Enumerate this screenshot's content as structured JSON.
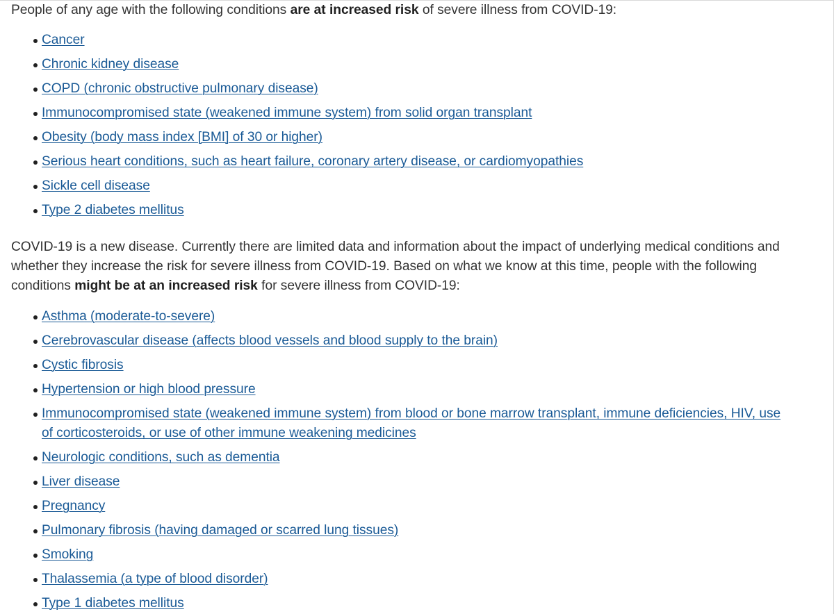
{
  "page": {
    "background_color": "#ffffff",
    "text_color": "#333333",
    "link_color": "#1a5a96"
  },
  "intro_paragraph": {
    "part1": "People of any age with the following conditions ",
    "emphasis": "are at increased risk",
    "part2": " of severe illness from COVID-19:"
  },
  "increased_risk_list": [
    {
      "label": "Cancer"
    },
    {
      "label": "Chronic kidney disease"
    },
    {
      "label": "COPD (chronic obstructive pulmonary disease)"
    },
    {
      "label": "Immunocompromised state (weakened immune system) from solid organ transplant"
    },
    {
      "label": "Obesity (body mass index [BMI] of 30 or higher)"
    },
    {
      "label": "Serious heart conditions, such as heart failure, coronary artery disease, or cardiomyopathies"
    },
    {
      "label": "Sickle cell disease"
    },
    {
      "label": "Type 2 diabetes mellitus"
    }
  ],
  "mid_paragraph": {
    "part1": "COVID-19 is a new disease. Currently there are limited data and information about the impact of underlying medical conditions and whether they increase the risk for severe illness from COVID-19. Based on what we know at this time, people with the following conditions ",
    "emphasis": "might be at an increased risk",
    "part2": " for severe illness from COVID-19:"
  },
  "might_be_at_risk_list": [
    {
      "label": "Asthma (moderate-to-severe)"
    },
    {
      "label": "Cerebrovascular disease (affects blood vessels and blood supply to the brain)"
    },
    {
      "label": "Cystic fibrosis"
    },
    {
      "label": "Hypertension or high blood pressure"
    },
    {
      "label": "Immunocompromised state (weakened immune system) from blood or bone marrow transplant, immune deficiencies, HIV, use of corticosteroids, or use of other immune weakening medicines"
    },
    {
      "label": "Neurologic conditions, such as dementia"
    },
    {
      "label": "Liver disease"
    },
    {
      "label": "Pregnancy"
    },
    {
      "label": "Pulmonary fibrosis (having damaged or scarred lung tissues)"
    },
    {
      "label": "Smoking"
    },
    {
      "label": "Thalassemia (a type of blood disorder)"
    },
    {
      "label": "Type 1 diabetes mellitus"
    }
  ]
}
